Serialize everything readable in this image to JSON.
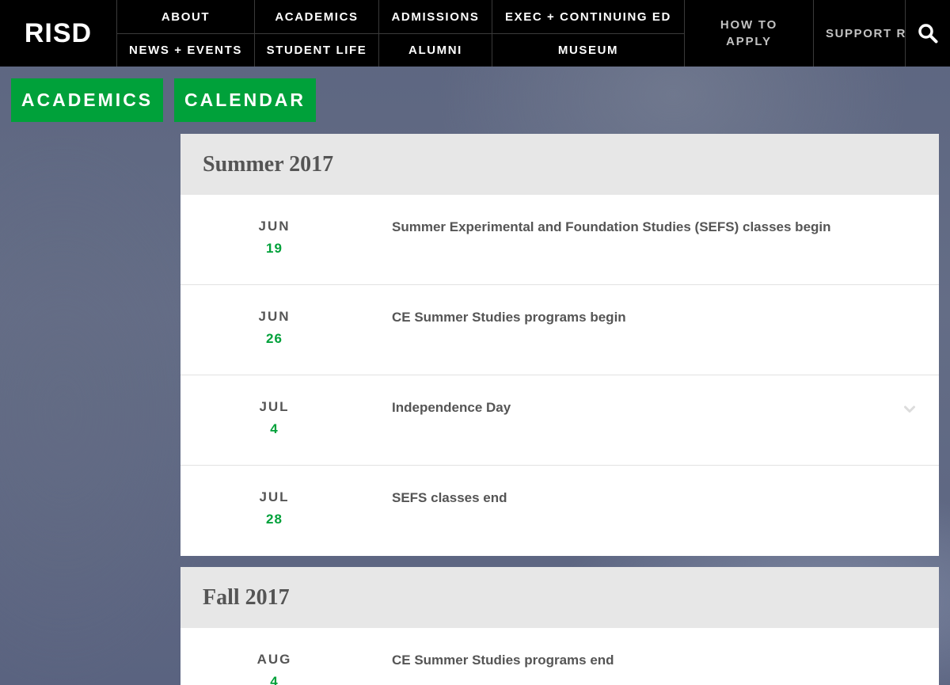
{
  "nav": {
    "logo": "RISD",
    "row1": [
      "ABOUT",
      "ACADEMICS",
      "ADMISSIONS",
      "EXEC + CONTINUING ED"
    ],
    "row2": [
      "NEWS + EVENTS",
      "STUDENT LIFE",
      "ALUMNI",
      "MUSEUM"
    ],
    "how_to_apply_line1": "HOW TO",
    "how_to_apply_line2": "APPLY",
    "support": "SUPPORT RISD",
    "search_icon": "search-icon"
  },
  "breadcrumb": [
    "ACADEMICS",
    "CALENDAR"
  ],
  "colors": {
    "accent_green": "#00a13a",
    "nav_bg": "#000000",
    "text_gray": "#555555"
  },
  "calendar": {
    "summer": {
      "title": "Summer 2017",
      "events": [
        {
          "month": "JUN",
          "day": "19",
          "title": "Summer Experimental and Foundation Studies (SEFS) classes begin"
        },
        {
          "month": "JUN",
          "day": "26",
          "title": "CE Summer Studies programs begin"
        },
        {
          "month": "JUL",
          "day": "4",
          "title": "Independence Day",
          "icon": "chevron-down-icon"
        },
        {
          "month": "JUL",
          "day": "28",
          "title": "SEFS classes end"
        }
      ]
    },
    "fall": {
      "title": "Fall 2017",
      "events": [
        {
          "month": "AUG",
          "day": "4",
          "title": "CE Summer Studies programs end"
        }
      ]
    }
  }
}
